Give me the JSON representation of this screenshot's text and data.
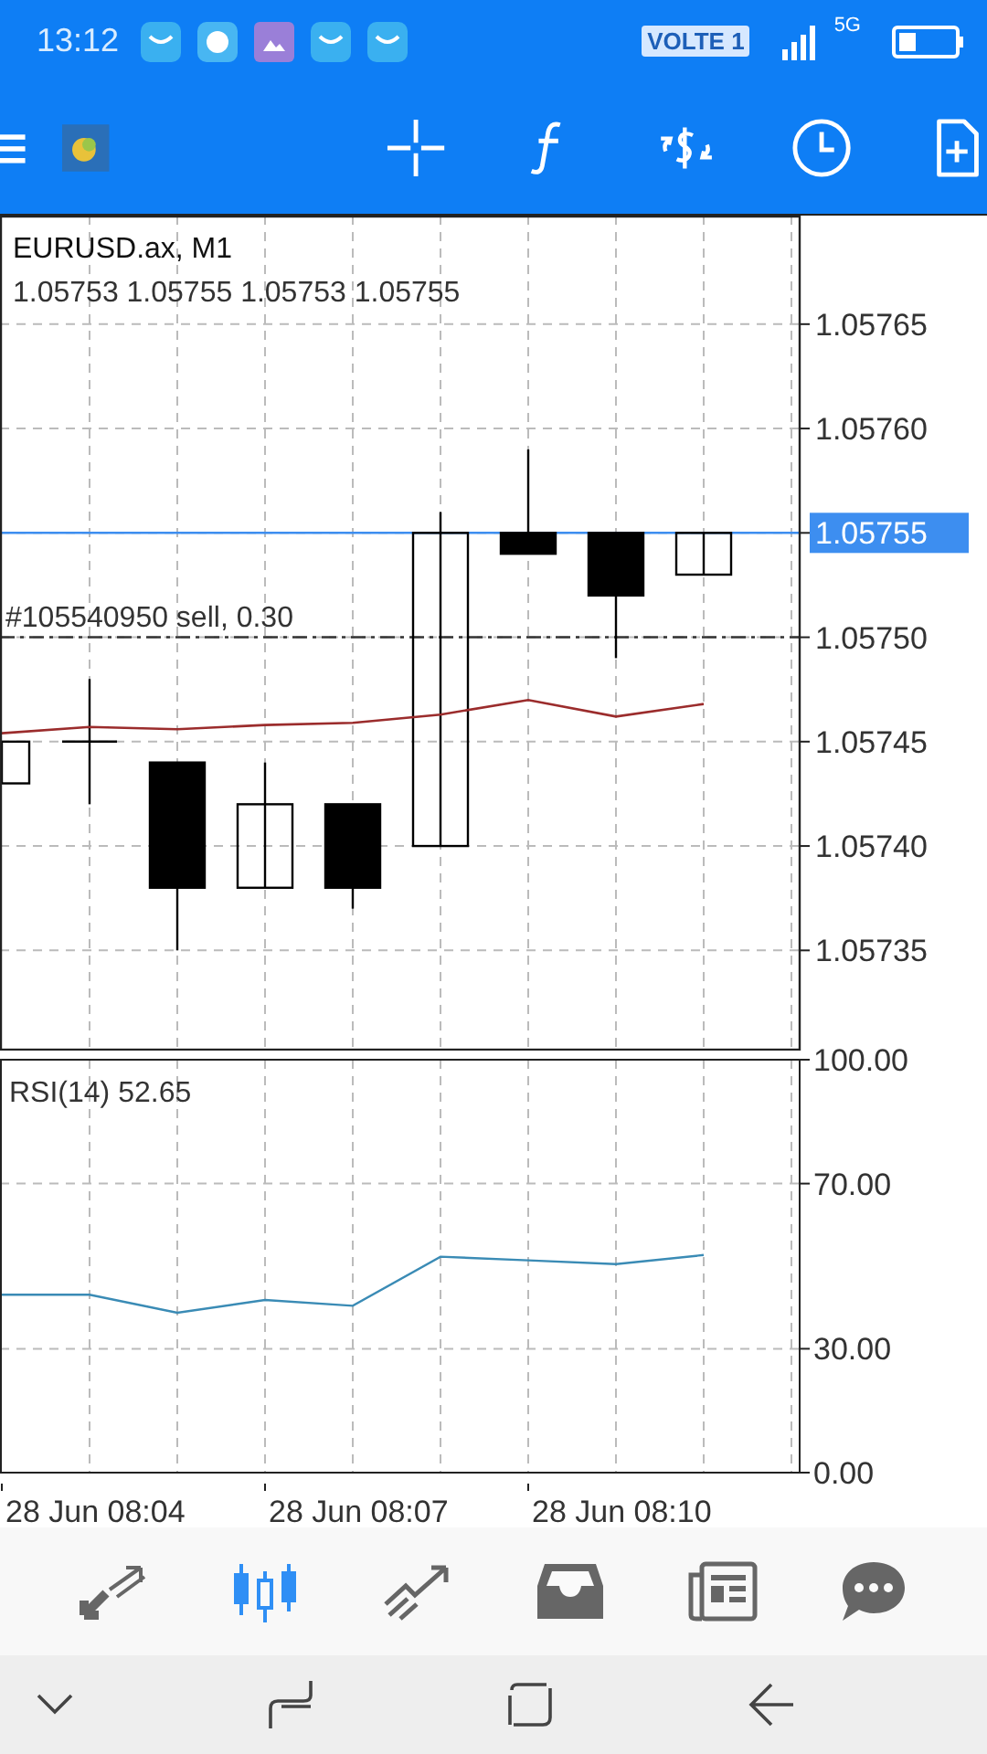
{
  "status_bar": {
    "time": "13:12",
    "badge": "VOLTE 1",
    "network": "5G"
  },
  "price_chart": {
    "title": "EURUSD.ax, M1",
    "ohlc": "1.05753 1.05755 1.05753 1.05755",
    "chart_data": {
      "type": "line",
      "categories": [
        null,
        null,
        null,
        null,
        null,
        null,
        null,
        null,
        null
      ],
      "grid": true,
      "series": [
        {
          "color": "#9b2c2c",
          "values": [
            1.057454,
            1.057457,
            1.057456,
            1.057458,
            1.057459,
            1.057463,
            1.05747,
            1.057462,
            1.057468
          ]
        }
      ],
      "ylim": [
        1.057302,
        1.057702
      ],
      "yticks": [
        {
          "value": 1.05765,
          "label": "1.05765"
        },
        {
          "value": 1.0576,
          "label": "1.05760"
        },
        1.05755,
        {
          "value": 1.0575,
          "label": "1.05750"
        },
        {
          "value": 1.05745,
          "label": "1.05745"
        },
        {
          "value": 1.0574,
          "label": "1.05740"
        },
        {
          "value": 1.05735,
          "label": "1.05735"
        }
      ],
      "ref_lines": [
        {
          "axis": "y",
          "value": 1.05755,
          "label": "1.05755",
          "color": "#3d8ef0"
        },
        {
          "axis": "y",
          "value": 1.0575,
          "label": "#105540950 sell, 0.30",
          "color": "#333333"
        }
      ]
    }
  },
  "rsi_chart": {
    "time_labels": [
      "28 Jun 08:04",
      "28 Jun 08:07",
      "28 Jun 08:10"
    ],
    "chart_data": {
      "type": "line",
      "title": "RSI(14) 52.65",
      "categories": [
        null,
        null,
        null,
        null,
        null,
        null,
        null,
        null,
        null
      ],
      "grid": true,
      "series": [
        {
          "color": "#3a8bb5",
          "values": [
            43.1,
            43.1,
            38.7,
            41.8,
            40.4,
            52.3,
            51.4,
            50.5,
            52.7
          ]
        }
      ],
      "ylim": [
        0,
        100
      ],
      "yticks": [
        {
          "value": 100,
          "label": "100.00"
        },
        {
          "value": 70,
          "label": "70.00"
        },
        {
          "value": 30,
          "label": "30.00"
        },
        {
          "value": 0,
          "label": "0.00"
        }
      ]
    }
  },
  "bottom_tabs": [
    {
      "kind": "trade",
      "selected": false
    },
    {
      "kind": "chart",
      "selected": true
    },
    {
      "kind": "trend",
      "selected": false
    },
    {
      "kind": "inbox",
      "selected": false
    },
    {
      "kind": "news",
      "selected": false
    },
    {
      "kind": "chat",
      "selected": false
    }
  ]
}
